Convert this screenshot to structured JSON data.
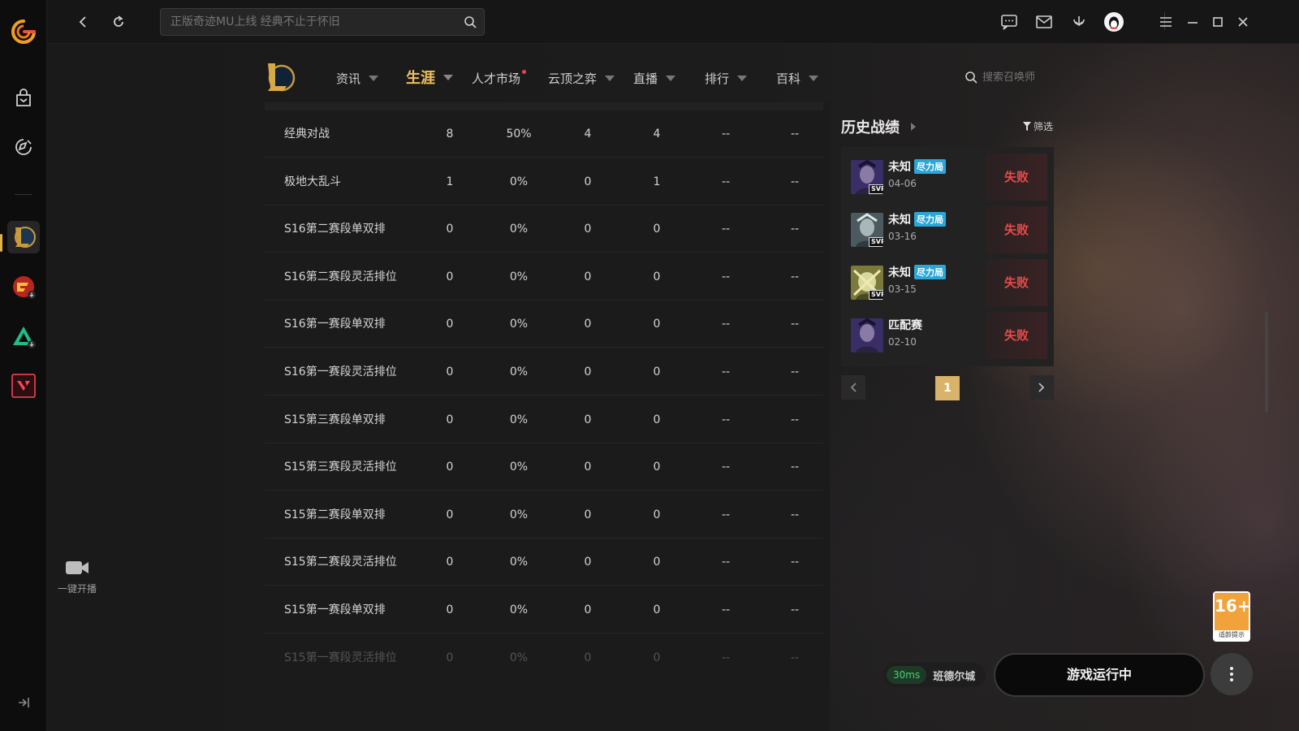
{
  "topbar": {
    "search_placeholder": "正版奇迹MU上线 经典不止于怀旧"
  },
  "left_rail": {
    "live_label": "一键开播"
  },
  "nav": {
    "tabs": [
      {
        "label": "资讯",
        "has_dropdown": true
      },
      {
        "label": "生涯",
        "has_dropdown": true,
        "active": true
      },
      {
        "label": "人才市场",
        "has_dropdown": false,
        "badge": "red-dot"
      },
      {
        "label": "云顶之弈",
        "has_dropdown": true
      },
      {
        "label": "直播",
        "has_dropdown": true
      },
      {
        "label": "排行",
        "has_dropdown": true
      },
      {
        "label": "百科",
        "has_dropdown": true
      }
    ],
    "summoner_search_placeholder": "搜索召唤师"
  },
  "stats_table": {
    "rows": [
      [
        "经典对战",
        "8",
        "50%",
        "4",
        "4",
        "--",
        "--"
      ],
      [
        "极地大乱斗",
        "1",
        "0%",
        "0",
        "1",
        "--",
        "--"
      ],
      [
        "S16第二赛段单双排",
        "0",
        "0%",
        "0",
        "0",
        "--",
        "--"
      ],
      [
        "S16第二赛段灵活排位",
        "0",
        "0%",
        "0",
        "0",
        "--",
        "--"
      ],
      [
        "S16第一赛段单双排",
        "0",
        "0%",
        "0",
        "0",
        "--",
        "--"
      ],
      [
        "S16第一赛段灵活排位",
        "0",
        "0%",
        "0",
        "0",
        "--",
        "--"
      ],
      [
        "S15第三赛段单双排",
        "0",
        "0%",
        "0",
        "0",
        "--",
        "--"
      ],
      [
        "S15第三赛段灵活排位",
        "0",
        "0%",
        "0",
        "0",
        "--",
        "--"
      ],
      [
        "S15第二赛段单双排",
        "0",
        "0%",
        "0",
        "0",
        "--",
        "--"
      ],
      [
        "S15第二赛段灵活排位",
        "0",
        "0%",
        "0",
        "0",
        "--",
        "--"
      ],
      [
        "S15第一赛段单双排",
        "0",
        "0%",
        "0",
        "0",
        "--",
        "--"
      ],
      [
        "S15第一赛段灵活排位",
        "0",
        "0%",
        "0",
        "0",
        "--",
        "--"
      ]
    ]
  },
  "history": {
    "title": "历史战绩",
    "filter_label": "筛选",
    "matches": [
      {
        "name": "未知",
        "tag": "尽力局",
        "date": "04-06",
        "result": "失败",
        "svp": "SVP"
      },
      {
        "name": "未知",
        "tag": "尽力局",
        "date": "03-16",
        "result": "失败",
        "svp": "SVP"
      },
      {
        "name": "未知",
        "tag": "尽力局",
        "date": "03-15",
        "result": "失败",
        "svp": "SVP"
      },
      {
        "name": "匹配赛",
        "tag": "",
        "date": "02-10",
        "result": "失败",
        "svp": ""
      }
    ],
    "page": "1"
  },
  "footer": {
    "ping": "30ms",
    "server": "班德尔城",
    "run_button": "游戏运行中",
    "age_rating": "16+",
    "age_caption": "适龄提示"
  },
  "colors": {
    "accent_gold": "#f0c060",
    "loss_red": "#e84a4a",
    "tag_blue": "#2aa6d8",
    "ping_green": "#4ccf74"
  }
}
